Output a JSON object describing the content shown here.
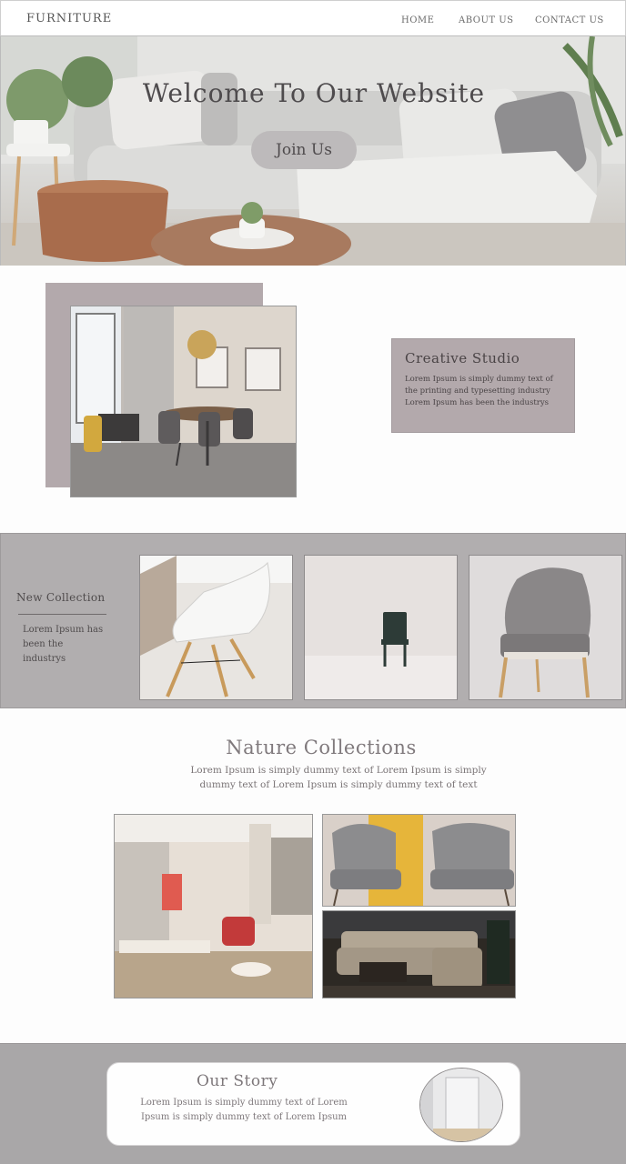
{
  "nav": {
    "brand": "FURNITURE",
    "links": [
      "HOME",
      "ABOUT US",
      "CONTACT US"
    ]
  },
  "hero": {
    "title": "Welcome To Our Website",
    "button": "Join Us"
  },
  "studio": {
    "title": "Creative Studio",
    "text": "Lorem Ipsum is simply dummy text of the printing and typesetting industry Lorem Ipsum has been the industrys"
  },
  "collection": {
    "title": "New Collection",
    "text": "Lorem Ipsum has been the industrys"
  },
  "nature": {
    "title": "Nature Collections",
    "text": "Lorem Ipsum is simply dummy text of Lorem Ipsum is simply dummy text of Lorem Ipsum is simply dummy text of text"
  },
  "story": {
    "title": "Our Story",
    "text": "Lorem Ipsum is simply dummy text of Lorem Ipsum is simply dummy text of Lorem Ipsum"
  },
  "colors": {
    "accent": "#b3a9ac",
    "band": "#b1aeaf",
    "story_band": "#a9a7a8",
    "text": "#6b6468"
  }
}
